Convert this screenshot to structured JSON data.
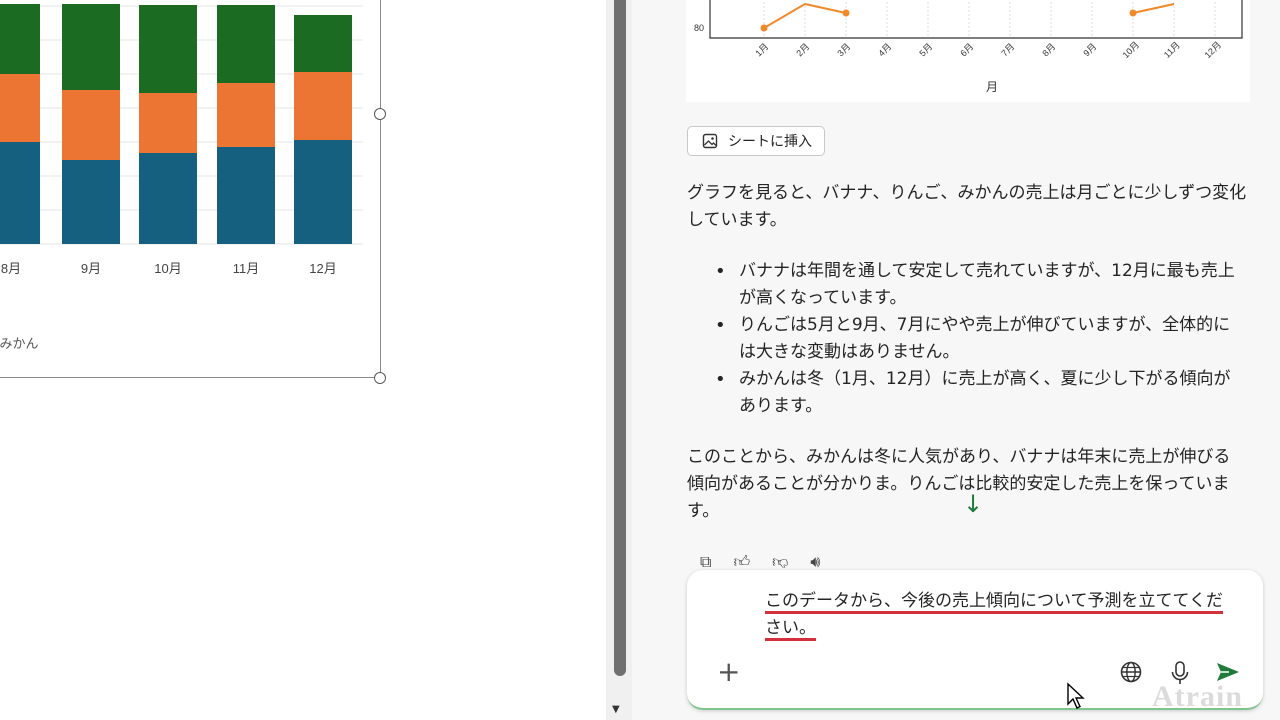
{
  "sheet": {
    "x_labels": [
      "8月",
      "9月",
      "10月",
      "11月",
      "12月"
    ],
    "legend_fragment": "/ みかん",
    "colors": {
      "banana": "#15607f",
      "apple": "#ec7533",
      "mikan": "#1c6b22"
    },
    "chart_data": {
      "type": "bar",
      "stacked": true,
      "categories": [
        "8月",
        "9月",
        "10月",
        "11月",
        "12月"
      ],
      "series": [
        {
          "values": [
            102,
            84,
            91,
            97,
            104
          ]
        },
        {
          "values": [
            68,
            70,
            60,
            64,
            68
          ]
        },
        {
          "values": [
            70,
            86,
            88,
            78,
            57
          ]
        }
      ]
    }
  },
  "chat": {
    "line_chart": {
      "type": "line",
      "xlabel": "月",
      "categories": [
        "1月",
        "2月",
        "3月",
        "4月",
        "5月",
        "6月",
        "7月",
        "8月",
        "9月",
        "10月",
        "11月",
        "12月"
      ],
      "y_tick": "80",
      "color": "#f0892a"
    },
    "insert_button": "シートに挿入",
    "para1": "グラフを見ると、バナナ、りんご、みかんの売上は月ごとに少しずつ変化しています。",
    "bullets": [
      "バナナは年間を通して安定して売れていますが、12月に最も売上が高くなっています。",
      "りんごは5月と9月、7月にやや売上が伸びていますが、全体的には大きな変動はありません。",
      "みかんは冬（1月、12月）に売上が高く、夏に少し下がる傾向があります。"
    ],
    "para2": "このことから、みかんは冬に人気があり、バナナは年末に売上が伸びる傾向があることが分かりま",
    "para2_rest": "。りんごは比較的安定した売上を保っています。",
    "composer_text": "このデータから、今後の売上傾向について予測を立ててください。"
  },
  "watermark": "Atrain"
}
